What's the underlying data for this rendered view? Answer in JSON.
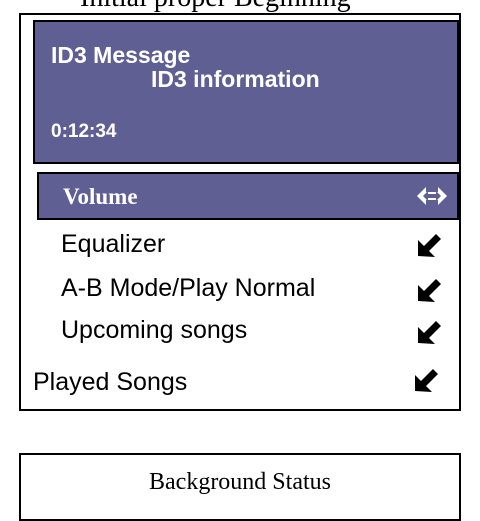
{
  "caption": {
    "text": "Initial proper Beginning"
  },
  "id3_panel": {
    "message": "ID3 Message",
    "information": "ID3 information",
    "elapsed_time": "0:12:34",
    "color": "#5f5f94"
  },
  "volume": {
    "label": "Volume",
    "icon": "double-arrow-horizontal-icon"
  },
  "menu_items": [
    {
      "label": "Equalizer",
      "icon": "arrow-down-left-icon"
    },
    {
      "label": "A-B Mode/Play Normal",
      "icon": "arrow-down-left-icon"
    },
    {
      "label": "Upcoming songs",
      "icon": "arrow-down-left-icon"
    },
    {
      "label": "Played Songs",
      "icon": "arrow-down-left-icon"
    }
  ],
  "status_bar": {
    "label": "Background Status"
  }
}
